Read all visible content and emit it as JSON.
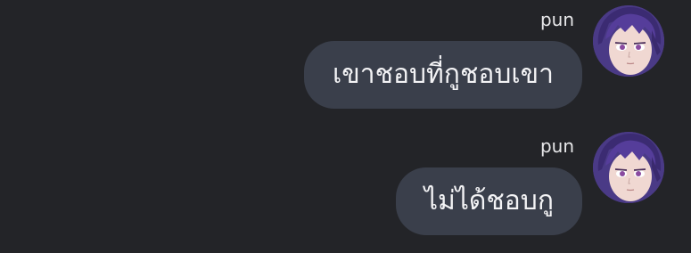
{
  "messages": [
    {
      "sender": "pun",
      "text": "เขาชอบที่กูชอบเขา",
      "avatar_icon": "anime-avatar-icon"
    },
    {
      "sender": "pun",
      "text": "ไม่ได้ชอบกู",
      "avatar_icon": "anime-avatar-icon"
    }
  ],
  "colors": {
    "background": "#232428",
    "bubble": "#3a3f4b",
    "text": "#f3f3f5"
  }
}
